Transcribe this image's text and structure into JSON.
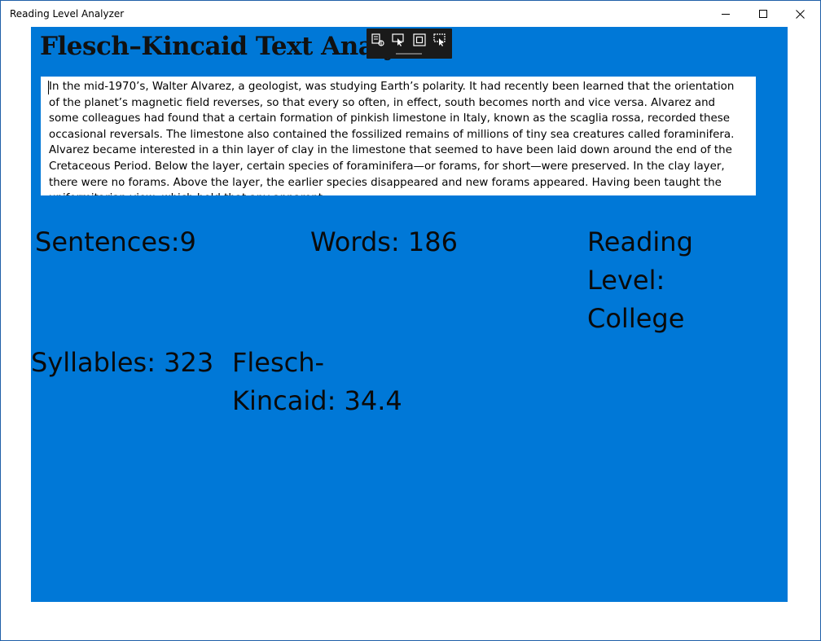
{
  "window": {
    "title": "Reading Level Analyzer",
    "controls": {
      "minimize": "minimize",
      "maximize": "maximize",
      "close": "close"
    }
  },
  "colors": {
    "content_background": "#0078d7",
    "textbox_background": "#ffffff",
    "toolbar_background": "#1a1a1a"
  },
  "app": {
    "heading": "Flesch–Kincaid Text Analyzer",
    "input_text": "In the mid-1970’s, Walter Alvarez, a geologist, was studying Earth’s polarity. It had recently been learned that the orientation of the planet’s magnetic field reverses, so that every so often, in effect, south becomes north and vice versa. Alvarez and some colleagues had found that a certain formation of pinkish limestone in Italy, known as the scaglia rossa, recorded these occasional reversals. The limestone also contained the fossilized remains of millions of tiny sea creatures called foraminifera. Alvarez became interested in a thin layer of clay in the limestone that seemed to have been laid down around the end of the Cretaceous Period. Below the layer, certain species of foraminifera—or forams, for short—were preserved. In the clay layer, there were no forams. Above the layer, the earlier species disappeared and new forams appeared. Having been taught the uniformitarian view, which held that any apparent",
    "stats": {
      "sentences": "Sentences:9",
      "words": "Words: 186",
      "reading_level": "Reading Level: College",
      "syllables": "Syllables: 323",
      "flesch_kincaid": "Flesch-Kincaid: 34.4"
    }
  },
  "debug_toolbar": {
    "icons": [
      "live-visual-tree-icon",
      "select-element-icon",
      "display-layout-adorners-icon",
      "track-focused-element-icon"
    ]
  }
}
